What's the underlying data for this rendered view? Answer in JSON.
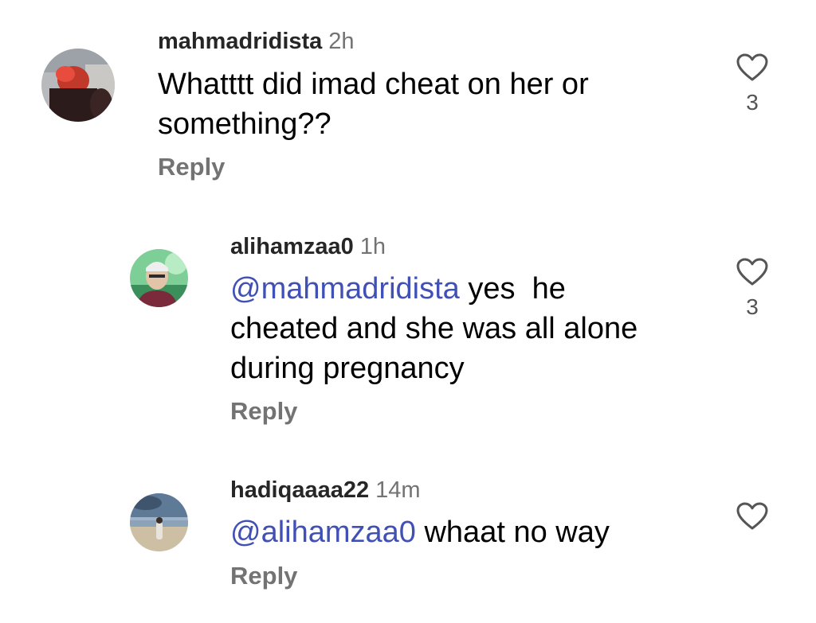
{
  "comments": [
    {
      "username": "mahmadridista",
      "time": "2h",
      "line1": "Whatttt did imad cheat on her or",
      "line2": "something??",
      "reply": "Reply",
      "likes": "3"
    },
    {
      "username": "alihamzaa0",
      "time": "1h",
      "mention": "@mahmadridista",
      "line1_rest": " yes  he",
      "line2": "cheated and she was all alone",
      "line3": "during pregnancy",
      "reply": "Reply",
      "likes": "3"
    },
    {
      "username": "hadiqaaaa22",
      "time": "14m",
      "mention": "@alihamzaa0",
      "line1_rest": " whaat no way",
      "reply": "Reply"
    }
  ],
  "colors": {
    "username": "#262626",
    "meta": "#737373",
    "mention": "#4150b5",
    "heart_stroke": "#555555"
  }
}
